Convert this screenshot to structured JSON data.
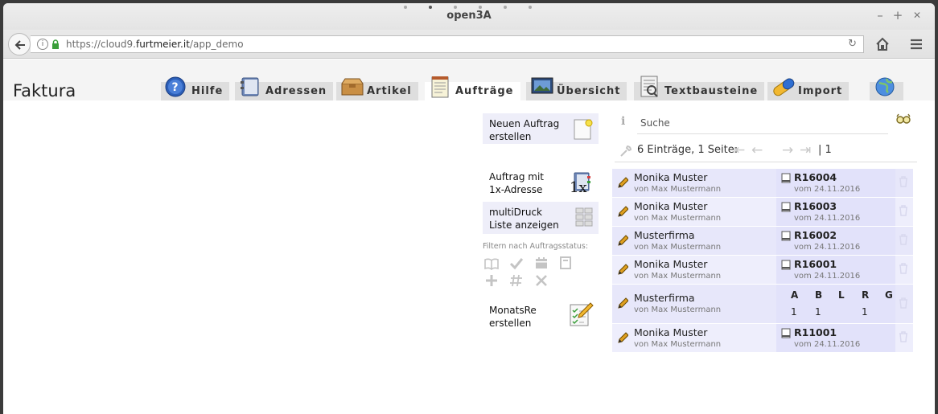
{
  "browser": {
    "title": "open3A",
    "url_prefix": "https://cloud9.",
    "url_domain": "furtmeier.it",
    "url_path": "/app_demo",
    "minimize": "–",
    "maximize": "+",
    "close": "✕"
  },
  "app": {
    "brand": "Faktura",
    "tabs": [
      {
        "label": "Hilfe",
        "icon": "help-icon"
      },
      {
        "label": "Adressen",
        "icon": "address-book-icon"
      },
      {
        "label": "Artikel",
        "icon": "box-icon"
      },
      {
        "label": "Aufträge",
        "icon": "notepad-icon",
        "active": true
      },
      {
        "label": "Übersicht",
        "icon": "monitor-icon"
      },
      {
        "label": "Textbausteine",
        "icon": "text-document-icon"
      },
      {
        "label": "Import",
        "icon": "pill-icon"
      },
      {
        "label": "",
        "icon": "globe-icon"
      }
    ]
  },
  "actions": {
    "new_order_line1": "Neuen Auftrag",
    "new_order_line2": "erstellen",
    "order_address_line1": "Auftrag mit",
    "order_address_line2": "1x-Adresse",
    "order_address_badge": "1x",
    "multiprint_line1": "multiDruck",
    "multiprint_line2": "Liste anzeigen",
    "filter_title": "Filtern nach Auftragsstatus:",
    "monthly_line1": "MonatsRe",
    "monthly_line2": "erstellen"
  },
  "list": {
    "search_placeholder": "Suche",
    "info_letter": "i",
    "summary": "6 Einträge, 1 Seite:",
    "page": "| 1",
    "rows": [
      {
        "name": "Monika Muster",
        "by": "von Max Mustermann",
        "number": "R16004",
        "date": "vom 24.11.2016"
      },
      {
        "name": "Monika Muster",
        "by": "von Max Mustermann",
        "number": "R16003",
        "date": "vom 24.11.2016"
      },
      {
        "name": "Musterfirma",
        "by": "von Max Mustermann",
        "number": "R16002",
        "date": "vom 24.11.2016"
      },
      {
        "name": "Monika Muster",
        "by": "von Max Mustermann",
        "number": "R16001",
        "date": "vom 24.11.2016"
      },
      {
        "name": "Musterfirma",
        "by": "von Max Mustermann"
      },
      {
        "name": "Monika Muster",
        "by": "von Max Mustermann",
        "number": "R11001",
        "date": "vom 24.11.2016"
      }
    ],
    "status_headers": [
      "A",
      "B",
      "L",
      "R",
      "G"
    ],
    "status_values": [
      "1",
      "1",
      "",
      "1",
      ""
    ]
  }
}
